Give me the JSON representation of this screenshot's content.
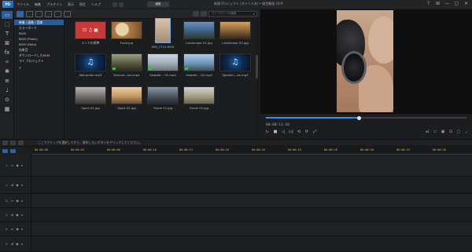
{
  "titlebar": {
    "logo_text": "PD",
    "menu": [
      "ファイル",
      "編集",
      "プラグイン",
      "表示",
      "再生",
      "ヘルプ"
    ],
    "mode_button": "編集",
    "project_title": "新規プロジェクト (タイトル名) • 縦型動画 16:9",
    "window_controls": [
      "?",
      "⊞",
      "—",
      "▢",
      "✕"
    ]
  },
  "vtools": [
    {
      "icon": "media-room-icon",
      "glyph": "▭",
      "active": true
    },
    {
      "icon": "import-icon",
      "glyph": "⬚",
      "active": false
    },
    {
      "icon": "title-icon",
      "glyph": "T",
      "active": false
    },
    {
      "icon": "transition-icon",
      "glyph": "⊠",
      "active": false
    },
    {
      "icon": "effects-icon",
      "glyph": "fx",
      "active": false
    },
    {
      "icon": "pip-icon",
      "glyph": "✧",
      "active": false
    },
    {
      "icon": "particle-icon",
      "glyph": "❋",
      "active": false
    },
    {
      "icon": "audio-mix-icon",
      "glyph": "≡",
      "active": false
    },
    {
      "icon": "voiceover-icon",
      "glyph": "♩",
      "active": false
    },
    {
      "icon": "mic-icon",
      "glyph": "⊙",
      "active": false
    },
    {
      "icon": "chapter-icon",
      "glyph": "▦",
      "active": false
    }
  ],
  "search": {
    "placeholder": "ライブラリーの検索"
  },
  "tree": {
    "items": [
      {
        "label": "映像 / 画像 / 音楽",
        "selected": true
      },
      {
        "label": "カラーボード",
        "selected": false
      },
      {
        "label": "BGM",
        "selected": false
      },
      {
        "label": "BGM (Pixels)",
        "selected": false
      },
      {
        "label": "BGM (Meta)",
        "selected": false
      },
      {
        "label": "効果音",
        "selected": false
      },
      {
        "label": "ダウンロードしたBGM",
        "selected": false
      },
      {
        "label": "マイ プロジェクト",
        "selected": false
      }
    ],
    "footer_glyph": "⌕"
  },
  "media": [
    {
      "caption": "エンドの標準",
      "type": "import",
      "color": "#c83a3a"
    },
    {
      "caption": "Food.jpg",
      "type": "photo",
      "color": "#c9a36b"
    },
    {
      "caption": "IMG_1712.MOV",
      "type": "video-selected",
      "color": "#bba38d"
    },
    {
      "caption": "Landscape 01.jpg",
      "type": "photo",
      "color": "#4a6f97"
    },
    {
      "caption": "Landscape 02.jpg",
      "type": "photo",
      "color": "#8b6a3f"
    },
    {
      "caption": "Mahoroba.mp3",
      "type": "music",
      "color": "#1d5fa8"
    },
    {
      "caption": "Mounta...ker.mp4",
      "type": "video",
      "color": "#6c6a4f"
    },
    {
      "caption": "Skatebl... 01.mp4",
      "type": "video",
      "color": "#a8b6c8"
    },
    {
      "caption": "Skatebl... 02.mp4",
      "type": "video",
      "color": "#7ea7c9"
    },
    {
      "caption": "Speakin...ak.mp3",
      "type": "music",
      "color": "#1d5fa8"
    },
    {
      "caption": "Sport 01.jpg",
      "type": "photo",
      "color": "#8a8580"
    },
    {
      "caption": "Sport 02.jpg",
      "type": "photo",
      "color": "#c5a27a"
    },
    {
      "caption": "Travel 01.jpg",
      "type": "photo",
      "color": "#596673"
    },
    {
      "caption": "Travel 02.jpg",
      "type": "photo",
      "color": "#a39a86"
    }
  ],
  "preview": {
    "timecode": "00:00:11:10",
    "progress": 0.46,
    "controls": [
      "▷",
      "■",
      "◁",
      "▷|",
      "⟲",
      "⟳",
      "⤢"
    ],
    "right_controls": [
      "◂)",
      "▭",
      "▣",
      "⊡",
      "▢",
      "⌄"
    ]
  },
  "timeline": {
    "hint": "ここでクリップを選択してから、操作したいボタンをクリックしてください。",
    "ruler": [
      "00:00:00",
      "00:00:03",
      "00:00:06",
      "00:00:10",
      "00:00:13",
      "00:00:16",
      "00:00:20",
      "00:00:23",
      "00:00:26",
      "00:00:30",
      "00:00:33",
      "00:00:36",
      "00:00:40"
    ],
    "tracks": [
      {
        "label": "1.",
        "kind": "video"
      },
      {
        "label": "1.",
        "kind": "audio"
      },
      {
        "label": "2.",
        "kind": "video"
      },
      {
        "label": "2.",
        "kind": "audio"
      },
      {
        "label": "3.",
        "kind": "video"
      },
      {
        "label": "3.",
        "kind": "audio"
      }
    ]
  }
}
